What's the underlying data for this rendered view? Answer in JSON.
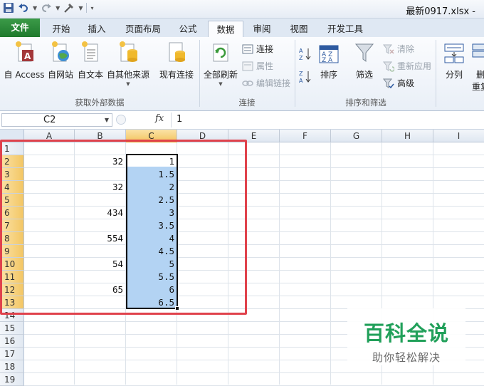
{
  "window": {
    "title": "最新0917.xlsx -"
  },
  "quick_access": {
    "icons": [
      "save-icon",
      "undo-icon",
      "redo-icon",
      "tools-icon",
      "customize-qat-icon"
    ]
  },
  "tabs": [
    "文件",
    "开始",
    "插入",
    "页面布局",
    "公式",
    "数据",
    "审阅",
    "视图",
    "开发工具"
  ],
  "active_tab": "数据",
  "ribbon": {
    "groups": {
      "external": "获取外部数据",
      "connections": "连接",
      "sort_filter": "排序和筛选"
    },
    "buttons": {
      "from_access": "自 Access",
      "from_web": "自网站",
      "from_text": "自文本",
      "from_other": "自其他来源",
      "existing": "现有连接",
      "refresh_all": "全部刷新",
      "connections": "连接",
      "properties": "属性",
      "edit_links": "编辑链接",
      "sort": "排序",
      "filter": "筛选",
      "clear": "清除",
      "reapply": "重新应用",
      "advanced": "高级",
      "text_to_columns": "分列",
      "remove_dup_top": "删",
      "remove_dup_bottom": "重复"
    }
  },
  "formula_bar": {
    "name_box": "C2",
    "fx": "fx",
    "value": "1"
  },
  "sheet": {
    "columns": [
      "A",
      "B",
      "C",
      "D",
      "E",
      "F",
      "G",
      "H",
      "I"
    ],
    "selected_column": "C",
    "rows": [
      "1",
      "2",
      "3",
      "4",
      "5",
      "6",
      "7",
      "8",
      "9",
      "10",
      "11",
      "12",
      "13",
      "14",
      "15",
      "16",
      "17",
      "18",
      "19"
    ],
    "selected_rows": [
      "2",
      "3",
      "4",
      "5",
      "6",
      "7",
      "8",
      "9",
      "10",
      "11",
      "12",
      "13"
    ],
    "col_b": {
      "2": "32",
      "4": "32",
      "6": "434",
      "8": "554",
      "10": "54",
      "12": "65"
    },
    "col_c": {
      "2": "1",
      "3": "1.5",
      "4": "2",
      "5": "2.5",
      "6": "3",
      "7": "3.5",
      "8": "4",
      "9": "4.5",
      "10": "5",
      "11": "5.5",
      "12": "6",
      "13": "6.5"
    },
    "selection_range": "C2:C13"
  },
  "colors": {
    "selection_fill": "#b3d3f3",
    "highlight_box": "#e0424c",
    "file_tab": "#1f7a2d",
    "watermark": "#21a05a"
  },
  "watermark": {
    "main": "百科全说",
    "sub": "助你轻松解决"
  }
}
